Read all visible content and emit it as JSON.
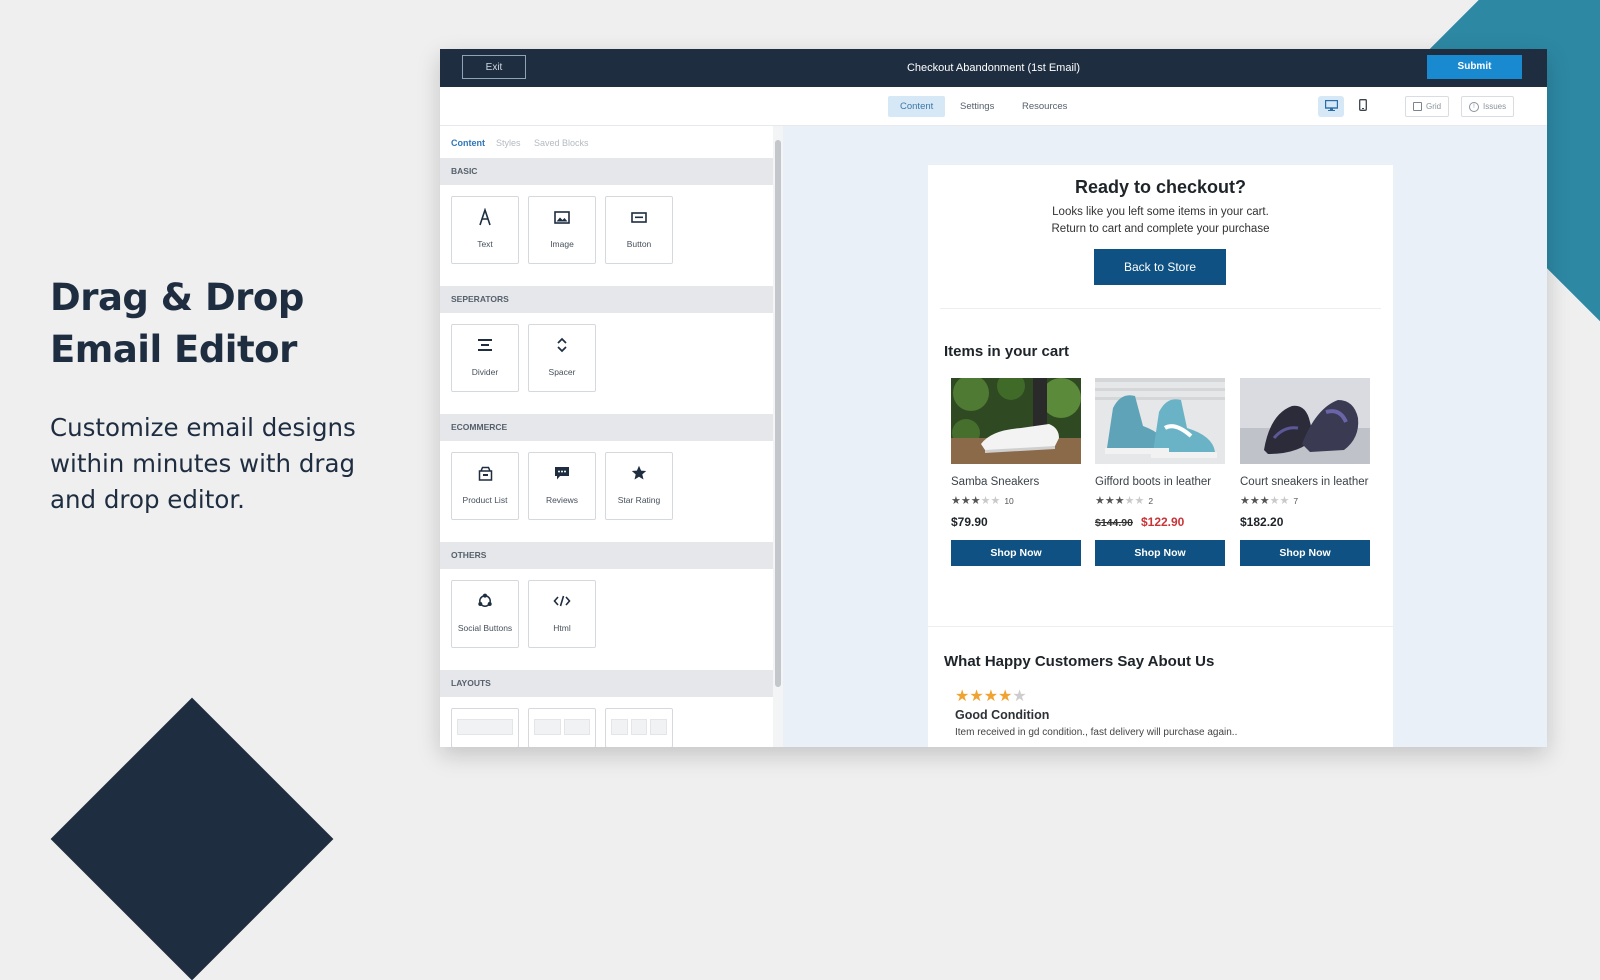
{
  "hero": {
    "title": "Drag & Drop Email Editor",
    "subtitle": "Customize email designs within minutes with drag and drop editor."
  },
  "topbar": {
    "exit_label": "Exit",
    "title": "Checkout Abandonment (1st Email)",
    "submit_label": "Submit"
  },
  "toolbar": {
    "tabs": [
      {
        "label": "Content",
        "active": true
      },
      {
        "label": "Settings",
        "active": false
      },
      {
        "label": "Resources",
        "active": false
      }
    ],
    "devices": {
      "desktop": "desktop-icon",
      "mobile": "mobile-icon",
      "active": "desktop"
    },
    "grid_label": "Grid",
    "issues_label": "Issues"
  },
  "sidebar": {
    "tabs": [
      {
        "label": "Content",
        "active": true
      },
      {
        "label": "Styles",
        "active": false
      },
      {
        "label": "Saved Blocks",
        "active": false
      }
    ],
    "sections": [
      {
        "title": "BASIC",
        "blocks": [
          {
            "label": "Text",
            "icon": "text-icon"
          },
          {
            "label": "Image",
            "icon": "image-icon"
          },
          {
            "label": "Button",
            "icon": "button-icon"
          }
        ]
      },
      {
        "title": "SEPERATORS",
        "blocks": [
          {
            "label": "Divider",
            "icon": "divider-icon"
          },
          {
            "label": "Spacer",
            "icon": "spacer-icon"
          }
        ]
      },
      {
        "title": "ECOMMERCE",
        "blocks": [
          {
            "label": "Product List",
            "icon": "product-list-icon"
          },
          {
            "label": "Reviews",
            "icon": "reviews-icon"
          },
          {
            "label": "Star Rating",
            "icon": "star-icon"
          }
        ]
      },
      {
        "title": "OTHERS",
        "blocks": [
          {
            "label": "Social Buttons",
            "icon": "social-icon"
          },
          {
            "label": "Html",
            "icon": "code-icon"
          }
        ]
      },
      {
        "title": "LAYOUTS",
        "layouts": [
          1,
          2,
          3
        ]
      }
    ]
  },
  "email": {
    "heading": "Ready to checkout?",
    "line1": "Looks like you left some items in your cart.",
    "line2": "Return to cart and complete your purchase",
    "back_button": "Back to Store",
    "items_heading": "Items in your cart",
    "products": [
      {
        "name": "Samba Sneakers",
        "rating": 3,
        "count": "10",
        "old_price": "",
        "price": "$79.90",
        "button": "Shop Now"
      },
      {
        "name": "Gifford boots in leather",
        "rating": 3,
        "count": "2",
        "old_price": "$144.90",
        "price": "$122.90",
        "button": "Shop Now"
      },
      {
        "name": "Court sneakers in leather",
        "rating": 3,
        "count": "7",
        "old_price": "",
        "price": "$182.20",
        "button": "Shop Now"
      }
    ],
    "reviews_heading": "What Happy Customers Say About Us",
    "review": {
      "rating": 4,
      "title": "Good Condition",
      "text": "Item received in gd condition., fast delivery will purchase again.."
    }
  },
  "colors": {
    "navy": "#1e2d40",
    "teal": "#2d88a4",
    "submit": "#1a8ad0",
    "email_button": "#0e5182",
    "sale": "#c93439",
    "star": "#f0a330"
  }
}
